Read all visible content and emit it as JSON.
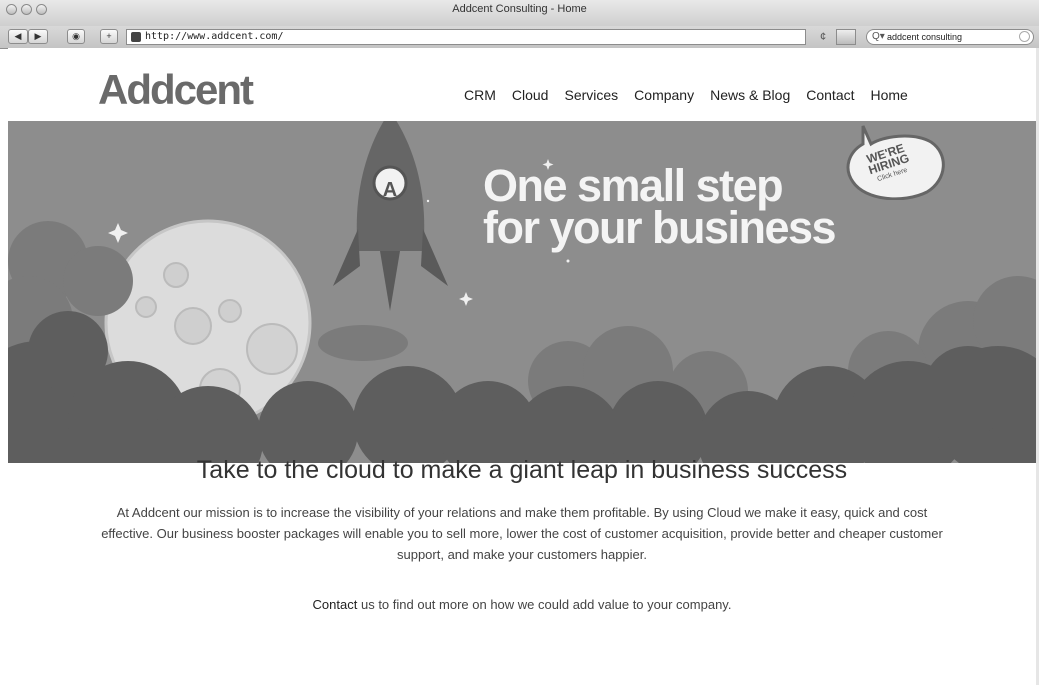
{
  "window": {
    "title": "Addcent Consulting - Home"
  },
  "toolbar": {
    "back_icon": "back-arrow-icon",
    "forward_icon": "forward-arrow-icon",
    "url": "http://www.addcent.com/",
    "search_value": "addcent consulting",
    "reload_glyph": "¢"
  },
  "site": {
    "logo": "Addcent",
    "nav": [
      "CRM",
      "Cloud",
      "Services",
      "Company",
      "News & Blog",
      "Contact",
      "Home"
    ],
    "hero": {
      "headline_line1": "One small step",
      "headline_line2": "for your business",
      "rocket_badge": "A",
      "hiring_line1": "WE'RE",
      "hiring_line2": "HIRING",
      "hiring_line3": "Click here"
    },
    "tagline": "Take to the cloud to make a giant leap in business success",
    "mission": "At Addcent our mission is to increase the visibility of your relations and make them profitable. By using Cloud we make it easy, quick and cost effective. Our business booster packages will enable you to sell more, lower the cost of customer acquisition, provide better and cheaper customer support, and make your customers happier.",
    "contact_link": "Contact",
    "contact_rest": " us to find out more on how we could add value to your company."
  },
  "colors": {
    "hero_background": "#8d8d8d",
    "logo": "#6a6a6a"
  }
}
